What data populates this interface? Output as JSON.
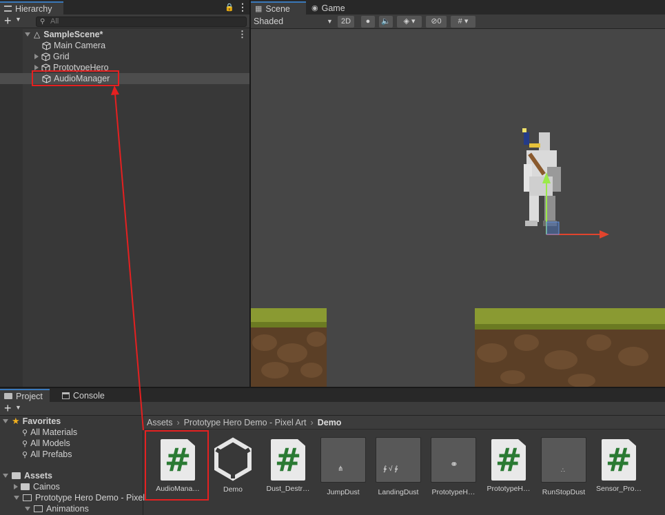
{
  "hierarchy": {
    "tab_label": "Hierarchy",
    "search_placeholder": "All",
    "scene_name": "SampleScene*",
    "objects": [
      "Main Camera",
      "Grid",
      "PrototypeHero",
      "AudioManager"
    ]
  },
  "scene_view": {
    "tabs": [
      "Scene",
      "Game"
    ],
    "shading_mode": "Shaded",
    "mode_2d": "2D",
    "hidden_count": "0"
  },
  "project": {
    "tabs": [
      "Project",
      "Console"
    ],
    "favorites_label": "Favorites",
    "favorites": [
      "All Materials",
      "All Models",
      "All Prefabs"
    ],
    "assets_label": "Assets",
    "folders": [
      "Cainos",
      "Prototype Hero Demo - Pixel",
      "Animations"
    ],
    "breadcrumb": [
      "Assets",
      "Prototype Hero Demo - Pixel Art",
      "Demo"
    ],
    "assets": [
      {
        "label": "AudioMana…",
        "type": "script"
      },
      {
        "label": "Demo",
        "type": "unity"
      },
      {
        "label": "Dust_Destr…",
        "type": "script"
      },
      {
        "label": "JumpDust",
        "type": "sprite"
      },
      {
        "label": "LandingDust",
        "type": "sprite"
      },
      {
        "label": "PrototypeH…",
        "type": "sprite"
      },
      {
        "label": "PrototypeH…",
        "type": "script"
      },
      {
        "label": "RunStopDust",
        "type": "sprite"
      },
      {
        "label": "Sensor_Pro…",
        "type": "script"
      }
    ]
  },
  "colors": {
    "highlight": "#e52020",
    "script_hash": "#2a7a33",
    "selected_row": "#4d4d4d",
    "tab_accent": "#3a79bb"
  }
}
